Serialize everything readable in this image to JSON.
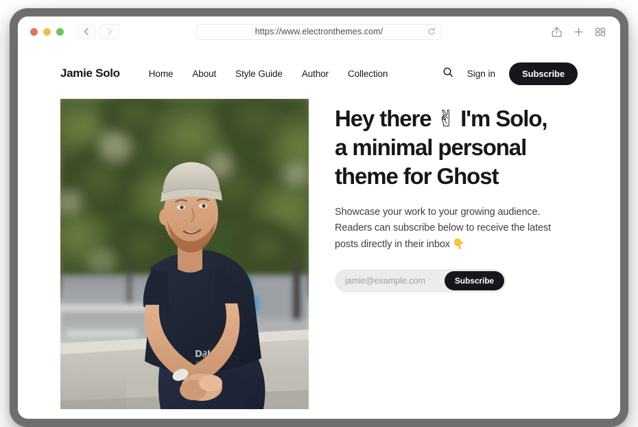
{
  "browser": {
    "url": "https://www.electronthemes.com/",
    "back_label": "Back",
    "forward_label": "Forward",
    "reload_label": "Reload",
    "share_label": "Share",
    "new_tab_label": "New Tab",
    "tab_overview_label": "Tab Overview",
    "traffic_lights": [
      {
        "name": "close",
        "color": "#e8705a"
      },
      {
        "name": "minimize",
        "color": "#f0bf4c"
      },
      {
        "name": "zoom",
        "color": "#6fc262"
      }
    ]
  },
  "site": {
    "logo": "Jamie Solo",
    "nav": [
      {
        "label": "Home"
      },
      {
        "label": "About"
      },
      {
        "label": "Style Guide"
      },
      {
        "label": "Author"
      },
      {
        "label": "Collection"
      }
    ],
    "search_label": "Search",
    "signin_label": "Sign in",
    "subscribe_label": "Subscribe"
  },
  "hero": {
    "title_line1_pre": "Hey there ",
    "title_emoji": "✌",
    "title_line1_post": " I'm Solo,",
    "title_line2": "a minimal personal",
    "title_line3": "theme for Ghost",
    "subtitle_line1": "Showcase your work to your growing audience.",
    "subtitle_line2": "Readers can subscribe below to receive the latest",
    "subtitle_line3": "posts directly in their inbox ",
    "subtitle_emoji": "👇",
    "image_alt": "Portrait of a bearded man wearing a light beanie and a dark navy t-shirt, sitting on a concrete ledge with blurred green trees behind him",
    "email_placeholder": "jamie@example.com",
    "email_value": "",
    "subscribe_label": "Subscribe"
  },
  "colors": {
    "accent": "#15171a",
    "page_background": "#ffffff",
    "input_background": "#ececec",
    "bezel": "#6e6e6e"
  }
}
